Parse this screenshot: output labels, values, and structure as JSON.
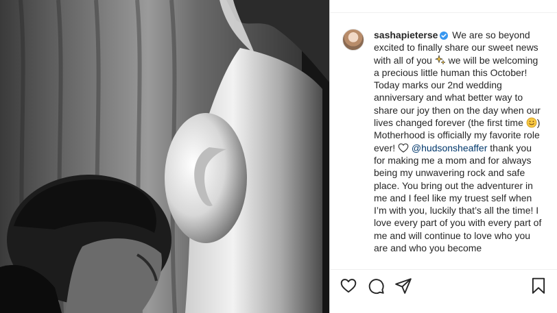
{
  "post": {
    "username": "sashapieterse",
    "verified": true,
    "caption_segments": {
      "part1": "We are so beyond excited to finally share our sweet news with all of you ",
      "part2": " we will be welcoming a precious little human this October! Today marks our 2nd wedding anniversary and what better way to share our joy then on the day when our lives changed forever (the first time ",
      "part3": ") Motherhood is officially my favorite role ever! ",
      "mention": "@hudsonsheaffer",
      "part4": " thank you for making me a mom and for always being my unwavering rock and safe place. You bring out the adventurer in me and I feel like my truest self when I’m with you, luckily that’s all the time! I love every part of you with every part of me and will continue to love who you are and who you become"
    },
    "icons": {
      "verified": "verified-badge-icon",
      "sparkles": "sparkles-emoji",
      "smile": "smiling-face-emoji",
      "heart_outline": "white-heart-emoji"
    }
  },
  "actions": {
    "like": "heart-icon",
    "comment": "comment-icon",
    "share": "share-icon",
    "save": "bookmark-icon"
  },
  "colors": {
    "text": "#262626",
    "mention": "#00376b",
    "verified": "#3897f0",
    "divider": "#efefef"
  }
}
